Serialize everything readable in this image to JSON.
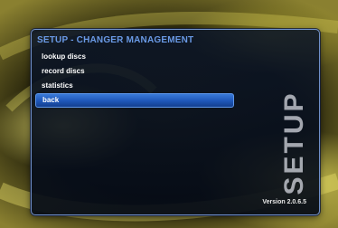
{
  "panel": {
    "title": "SETUP - CHANGER MANAGEMENT",
    "side_label": "SETUP",
    "version": "Version 2.0.6.5"
  },
  "menu": {
    "items": [
      {
        "label": "lookup discs",
        "selected": false
      },
      {
        "label": "record discs",
        "selected": false
      },
      {
        "label": "statistics",
        "selected": false
      },
      {
        "label": "back",
        "selected": true
      }
    ]
  },
  "colors": {
    "title_blue": "#6a9ae6",
    "selection_blue": "#1e56b8",
    "panel_border": "#6f8fc8",
    "background_gold": "#c8bd3c"
  }
}
